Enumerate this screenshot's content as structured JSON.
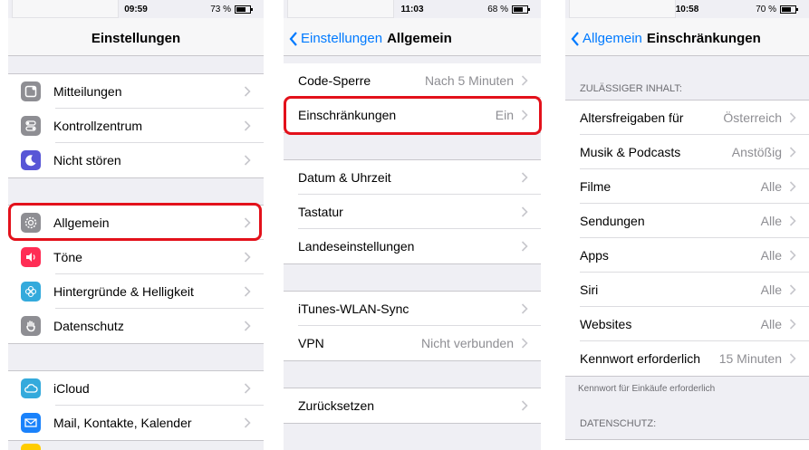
{
  "panel1": {
    "time": "09:59",
    "battery": "73 %",
    "battery_level": 0.73,
    "title": "Einstellungen",
    "groups": [
      [
        {
          "label": "Mitteilungen",
          "icon": "notifications-icon",
          "color": "#8e8e93"
        },
        {
          "label": "Kontrollzentrum",
          "icon": "control-center-icon",
          "color": "#8e8e93"
        },
        {
          "label": "Nicht stören",
          "icon": "moon-icon",
          "color": "#5856d6"
        }
      ],
      [
        {
          "label": "Allgemein",
          "icon": "gear-icon",
          "color": "#8e8e93"
        },
        {
          "label": "Töne",
          "icon": "speaker-icon",
          "color": "#ff2d55"
        },
        {
          "label": "Hintergründe & Helligkeit",
          "icon": "wallpaper-icon",
          "color": "#34aadc"
        },
        {
          "label": "Datenschutz",
          "icon": "hand-icon",
          "color": "#8e8e93"
        }
      ],
      [
        {
          "label": "iCloud",
          "icon": "cloud-icon",
          "color": "#34aadc"
        },
        {
          "label": "Mail, Kontakte, Kalender",
          "icon": "mail-icon",
          "color": "#1a82fb"
        }
      ]
    ]
  },
  "panel2": {
    "time": "11:03",
    "battery": "68 %",
    "battery_level": 0.68,
    "back": "Einstellungen",
    "title": "Allgemein",
    "groups": [
      [
        {
          "label": "Code-Sperre",
          "value": "Nach 5 Minuten"
        },
        {
          "label": "Einschränkungen",
          "value": "Ein"
        }
      ],
      [
        {
          "label": "Datum & Uhrzeit",
          "value": ""
        },
        {
          "label": "Tastatur",
          "value": ""
        },
        {
          "label": "Landeseinstellungen",
          "value": ""
        }
      ],
      [
        {
          "label": "iTunes-WLAN-Sync",
          "value": ""
        },
        {
          "label": "VPN",
          "value": "Nicht verbunden"
        }
      ],
      [
        {
          "label": "Zurücksetzen",
          "value": ""
        }
      ]
    ]
  },
  "panel3": {
    "time": "10:58",
    "battery": "70 %",
    "battery_level": 0.7,
    "back": "Allgemein",
    "title": "Einschränkungen",
    "header1": "ZULÄSSIGER INHALT:",
    "rows": [
      {
        "label": "Altersfreigaben für",
        "value": "Österreich"
      },
      {
        "label": "Musik & Podcasts",
        "value": "Anstößig"
      },
      {
        "label": "Filme",
        "value": "Alle"
      },
      {
        "label": "Sendungen",
        "value": "Alle"
      },
      {
        "label": "Apps",
        "value": "Alle"
      },
      {
        "label": "Siri",
        "value": "Alle"
      },
      {
        "label": "Websites",
        "value": "Alle"
      },
      {
        "label": "Kennwort erforderlich",
        "value": "15 Minuten"
      }
    ],
    "footer": "Kennwort für Einkäufe erforderlich",
    "header2": "DATENSCHUTZ:"
  },
  "highlight_color": "#e3111b"
}
